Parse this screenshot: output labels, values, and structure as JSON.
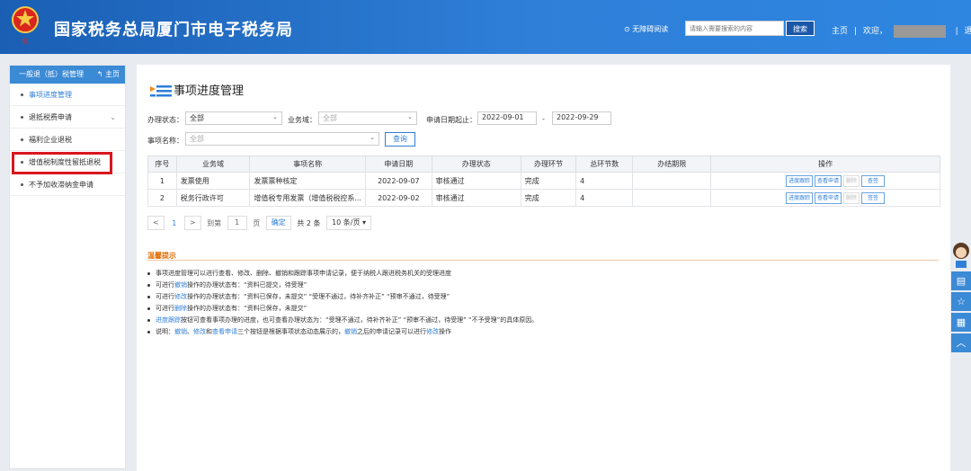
{
  "header": {
    "site_title": "国家税务总局厦门市电子税务局",
    "accessibility": "⊙ 无障碍阅读",
    "search_placeholder": "请输入需要搜索的内容",
    "search_button": "搜索",
    "home": "主页",
    "welcome": "欢迎，",
    "logout": "退出",
    "separator": "|"
  },
  "sidebar": {
    "heading": "一般退（抵）税管理",
    "home_link": "↰ 主页",
    "items": [
      {
        "label": "事项进度管理"
      },
      {
        "label": "退抵税费申请"
      },
      {
        "label": "福利企业退税"
      },
      {
        "label": "增值税制度性留抵退税"
      },
      {
        "label": "不予加收滞纳金申请"
      }
    ]
  },
  "page": {
    "title": "事项进度管理",
    "filters": {
      "status_label": "办理状态：",
      "status_value": "全部",
      "domain_label": "业务域：",
      "domain_value": "全部",
      "date_label": "申请日期起止：",
      "date_from": "2022-09-01",
      "date_sep": "-",
      "date_to": "2022-09-29",
      "item_label": "事项名称：",
      "item_value": "全部",
      "query_button": "查询"
    },
    "table": {
      "headers": [
        "序号",
        "业务域",
        "事项名称",
        "申请日期",
        "办理状态",
        "办理环节",
        "总环节数",
        "办结期限",
        "操作"
      ],
      "rows": [
        {
          "no": "1",
          "domain": "发票使用",
          "name": "发票票种核定",
          "date": "2022-09-07",
          "status": "审核通过",
          "step": "完成",
          "total": "4",
          "deadline": ""
        },
        {
          "no": "2",
          "domain": "税务行政许可",
          "name": "增值税专用发票（增值税税控系...",
          "date": "2022-09-02",
          "status": "审核通过",
          "step": "完成",
          "total": "4",
          "deadline": ""
        }
      ],
      "ops": {
        "track": "进度跟踪",
        "view": "查看申请",
        "delete": "删除",
        "review": "查签",
        "sign": "签签"
      }
    },
    "pager": {
      "prev": "<",
      "page": "1",
      "next": ">",
      "goto_label": "到第",
      "goto_value": "1",
      "page_unit": "页",
      "confirm": "确定",
      "total": "共 2 条",
      "page_size": "10 条/页 ▾"
    },
    "tips": {
      "title": "温馨提示",
      "lines": [
        {
          "segments": [
            "事项进度管理可以进行查看、修改、删除、撤销和跟踪事项申请记录，便于纳税人跟进税务机关的受理进度"
          ]
        },
        {
          "segments": [
            "可进行",
            "撤销",
            "操作的办理状态有：“资料已提交，待受理”"
          ]
        },
        {
          "segments": [
            "可进行",
            "修改",
            "操作的办理状态有：“资料已保存，未提交”  “受理不通过，待补齐补正”  “预审不通过，待受理”"
          ]
        },
        {
          "segments": [
            "可进行",
            "删除",
            "操作的办理状态有：“资料已保存，未提交”"
          ]
        },
        {
          "segments": [
            "",
            "进度跟踪",
            "按钮可查看事项办理的进度，也可查看办理状态为：“受理不通过，待补齐补正”  “预审不通过，待受理”  “不予受理”的具体原因。"
          ]
        },
        {
          "segments": [
            "说明：",
            "撤销",
            "、",
            "修改",
            "和",
            "查看申请",
            "三个按钮是根据事项状态动态展示的，",
            "撤销",
            "之后的申请记录可以进行",
            "修改",
            "操作"
          ]
        }
      ]
    }
  },
  "colors": {
    "header_blue": "#2f7fd8",
    "highlight_red": "#d9161d",
    "tips_orange": "#e06b00"
  },
  "icons": [
    "national-emblem-icon",
    "title-list-icon",
    "customer-service-avatar-icon",
    "document-icon",
    "star-icon",
    "calculator-icon",
    "chevron-up-icon"
  ]
}
